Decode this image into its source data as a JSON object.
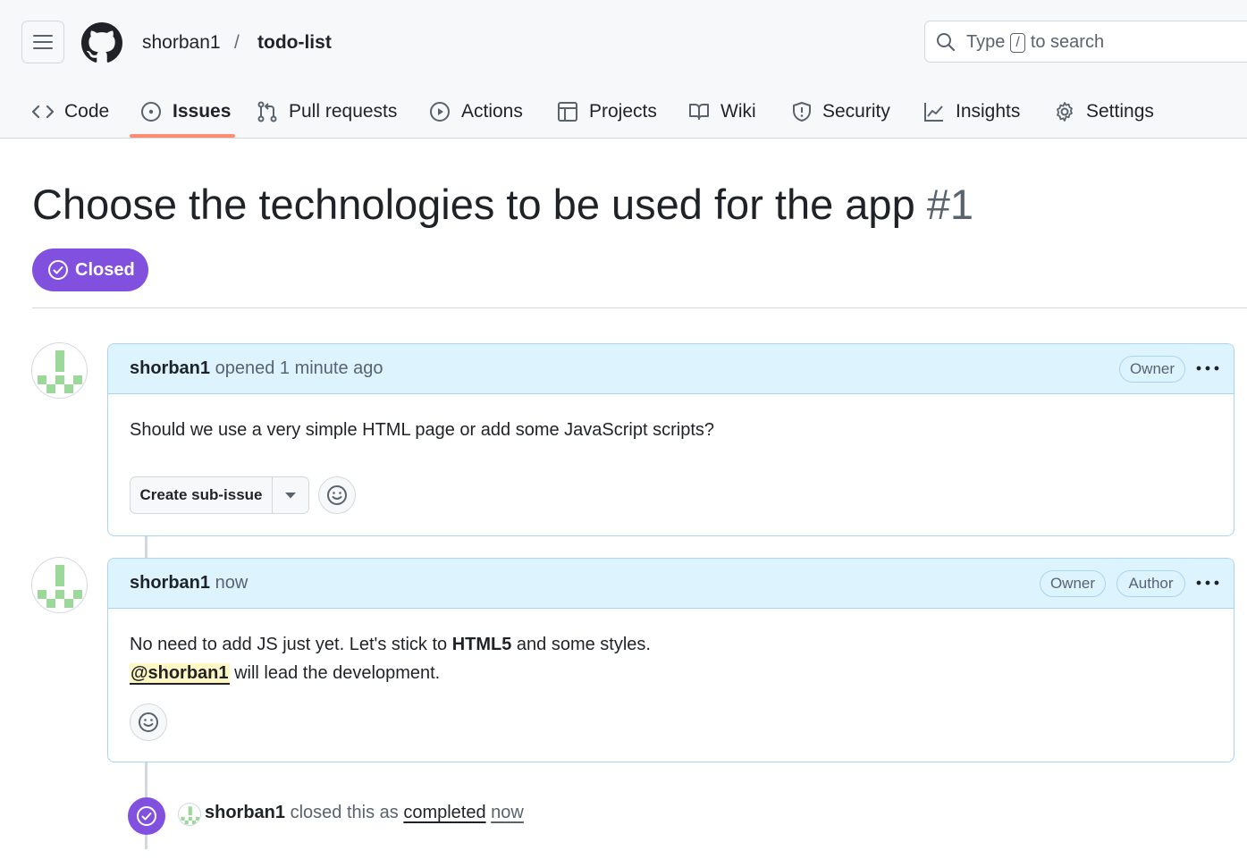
{
  "header": {
    "owner": "shorban1",
    "separator": "/",
    "repo": "todo-list",
    "search": {
      "prefix": "Type",
      "key": "/",
      "suffix": "to search"
    }
  },
  "tabs": [
    {
      "label": "Code",
      "icon": "code-icon"
    },
    {
      "label": "Issues",
      "icon": "issue-opened-icon",
      "active": true
    },
    {
      "label": "Pull requests",
      "icon": "git-pull-request-icon"
    },
    {
      "label": "Actions",
      "icon": "play-icon"
    },
    {
      "label": "Projects",
      "icon": "table-icon"
    },
    {
      "label": "Wiki",
      "icon": "book-icon"
    },
    {
      "label": "Security",
      "icon": "shield-icon"
    },
    {
      "label": "Insights",
      "icon": "graph-icon"
    },
    {
      "label": "Settings",
      "icon": "gear-icon"
    }
  ],
  "issue": {
    "title": "Choose the technologies to be used for the app",
    "number": "#1",
    "state": "Closed"
  },
  "comments": [
    {
      "author": "shorban1",
      "meta": "opened 1 minute ago",
      "labels": [
        "Owner"
      ],
      "body": "Should we use a very simple HTML page or add some JavaScript scripts?",
      "sub_issue_button": "Create sub-issue"
    },
    {
      "author": "shorban1",
      "meta": "now",
      "labels": [
        "Owner",
        "Author"
      ],
      "body_line1_pre": "No need to add JS just yet. Let's stick to",
      "body_line1_bold": "HTML5",
      "body_line1_post": "and some styles.",
      "body_line2_mention": "@shorban1",
      "body_line2_post": "will lead the development."
    }
  ],
  "event": {
    "actor": "shorban1",
    "text": "closed this as",
    "link": "completed",
    "time": "now"
  },
  "colors": {
    "closed_purple": "#8250df",
    "header_bg": "#f6f8fa",
    "comment_header_bg": "#ddf4ff",
    "active_tab_underline": "#fd8c73",
    "identicon_green": "#9bd89a"
  }
}
